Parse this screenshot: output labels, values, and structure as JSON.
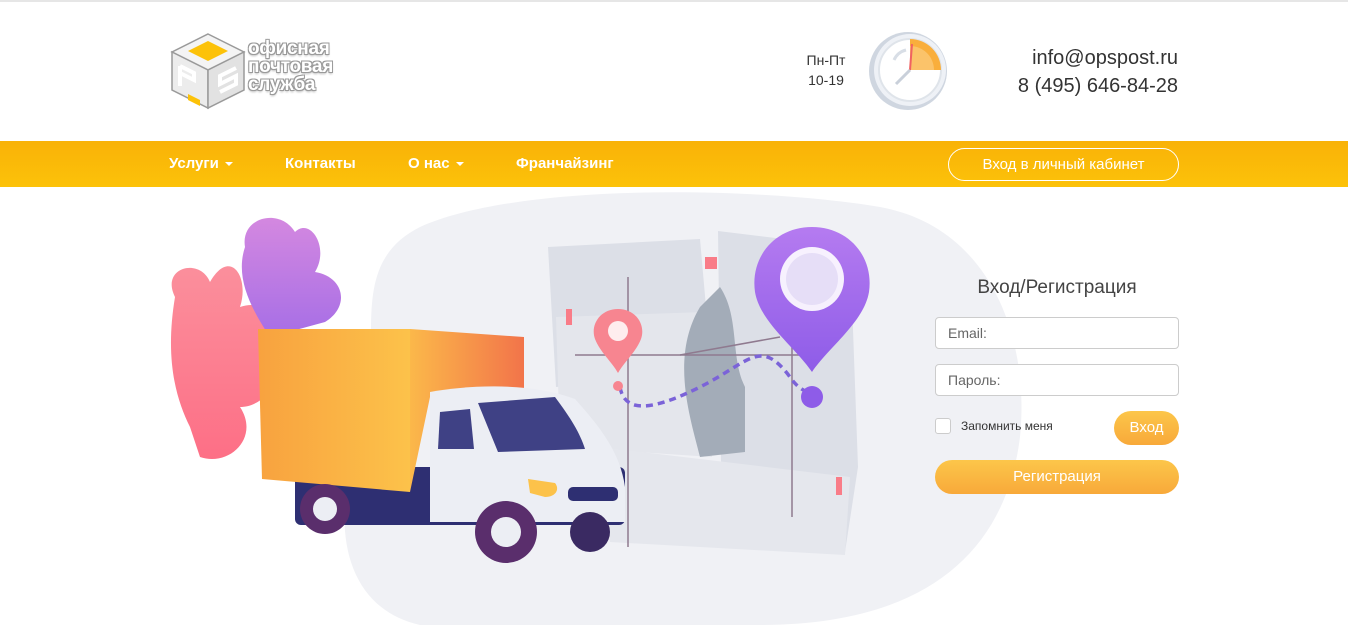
{
  "brand": {
    "logo_lines": [
      "офисная",
      "почтовая",
      "служба"
    ],
    "logo_mark": "PS"
  },
  "header": {
    "hours_days": "Пн-Пт",
    "hours_time": "10-19",
    "email": "info@opspost.ru",
    "phone": "8 (495) 646-84-28",
    "icons": [
      "clock-icon"
    ]
  },
  "nav": {
    "items": [
      {
        "label": "Услуги",
        "has_dropdown": true
      },
      {
        "label": "Контакты",
        "has_dropdown": false
      },
      {
        "label": "О нас",
        "has_dropdown": true
      },
      {
        "label": "Франчайзинг",
        "has_dropdown": false
      }
    ],
    "login_label": "Вход в личный кабинет",
    "bar_color": "#fbbd09"
  },
  "auth_form": {
    "title": "Вход/Регистрация",
    "email_placeholder": "Email:",
    "password_placeholder": "Пароль:",
    "remember_label": "Запомнить меня",
    "submit_label": "Вход",
    "register_label": "Регистрация",
    "button_color": "#f9b540"
  },
  "hero": {
    "illustration": "delivery-truck-map-illustration",
    "icons": [
      "truck-icon",
      "map-pin-icon",
      "map-icon"
    ]
  }
}
